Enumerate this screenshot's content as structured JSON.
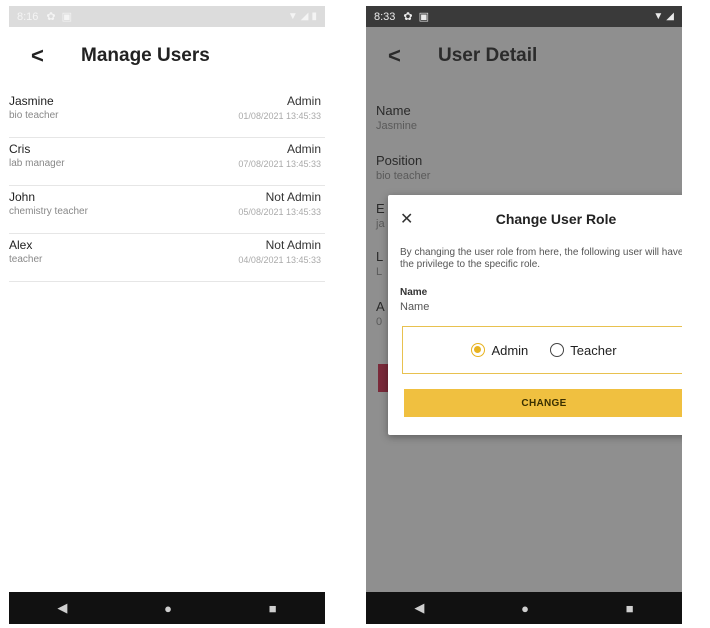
{
  "left_screen": {
    "status_bar": {
      "time": "8:16"
    },
    "header": {
      "title": "Manage Users"
    },
    "users": [
      {
        "name": "Jasmine",
        "position": "bio teacher",
        "role": "Admin",
        "date": "01/08/2021 13:45:33"
      },
      {
        "name": "Cris",
        "position": "lab manager",
        "role": "Admin",
        "date": "07/08/2021 13:45:33"
      },
      {
        "name": "John",
        "position": "chemistry teacher",
        "role": "Not Admin",
        "date": "05/08/2021 13:45:33"
      },
      {
        "name": "Alex",
        "position": "teacher",
        "role": "Not Admin",
        "date": "04/08/2021 13:45:33"
      }
    ]
  },
  "right_screen": {
    "status_bar": {
      "time": "8:33"
    },
    "header": {
      "title": "User Detail"
    },
    "details": {
      "name_label": "Name",
      "name_value": "Jasmine",
      "position_label": "Position",
      "position_value": "bio teacher",
      "partial_label_1": "E",
      "partial_value_1": "ja",
      "partial_label_2": "L",
      "partial_value_2": "L",
      "partial_label_3": "A",
      "partial_value_3": "0"
    },
    "dialog": {
      "title": "Change User Role",
      "description": "By changing the user role from here, the following user will have the privilege to the specific role.",
      "name_label": "Name",
      "name_value": "Name",
      "options": [
        "Admin",
        "Teacher"
      ],
      "selected_option": "Admin",
      "button_label": "CHANGE"
    }
  },
  "colors": {
    "accent": "#f0c040",
    "radio_selected": "#e8b321",
    "overlay": "#8f8f8f"
  }
}
